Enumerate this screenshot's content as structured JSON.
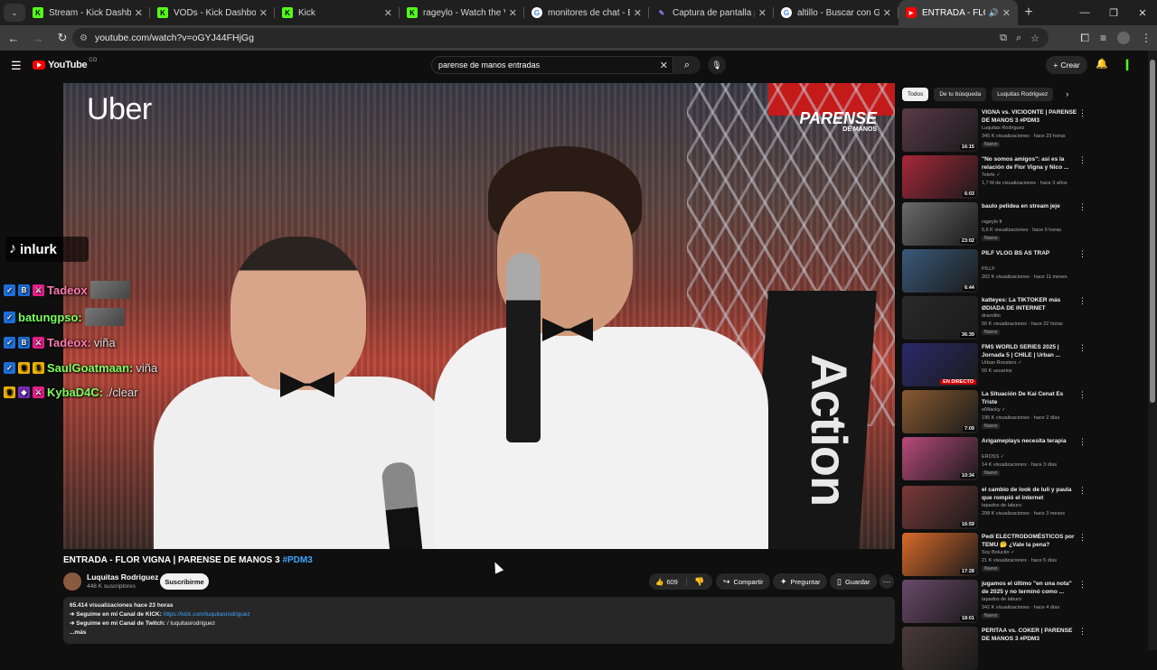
{
  "browser": {
    "tabs": [
      {
        "title": "Stream - Kick Dashboard",
        "favicon": "kick-icon"
      },
      {
        "title": "VODs - Kick Dashboard",
        "favicon": "kick-icon"
      },
      {
        "title": "Kick",
        "favicon": "kick-icon"
      },
      {
        "title": "rageylo - Watch the VOD",
        "favicon": "kick-icon"
      },
      {
        "title": "monitores de chat - Buscar",
        "favicon": "google-icon"
      },
      {
        "title": "Captura de pantalla por L",
        "favicon": "pen-icon"
      },
      {
        "title": "altillo - Buscar con Goog",
        "favicon": "google-icon"
      },
      {
        "title": "ENTRADA - FLOR VIG",
        "favicon": "youtube-icon",
        "active": true
      }
    ],
    "url": "youtube.com/watch?v=oGYJ44FHjGg"
  },
  "youtube": {
    "logo": "YouTube",
    "logo_suffix": "CO",
    "search_query": "parense de manos entradas",
    "create_label": "Crear"
  },
  "player": {
    "sponsor": "Uber",
    "watermark": "PARENSE",
    "watermark_sub": "DE MANOS",
    "pillar_text": "Action"
  },
  "overlay": {
    "tiktok_name": "inlurk",
    "chat": [
      {
        "user": "Tadeox",
        "msg": ""
      },
      {
        "user": "batungpso:",
        "msg": ""
      },
      {
        "user": "Tadeox:",
        "msg": "viña"
      },
      {
        "user": "SaulGoatmaan:",
        "msg": "viña"
      },
      {
        "user": "KybaD4C:",
        "msg": "./clear"
      }
    ]
  },
  "video": {
    "title": "ENTRADA - FLOR VIGNA | PARENSE DE MANOS 3",
    "hashtag": "#PDM3",
    "channel": "Luquitas Rodriguez",
    "subscribers": "448 K suscriptores",
    "subscribe_label": "Suscribirme",
    "likes": "609",
    "share_label": "Compartir",
    "ask_label": "Preguntar",
    "save_label": "Guardar",
    "description": {
      "stats": "65.414 visualizaciones  hace 23 horas",
      "line1_prefix": "➔ Seguime en mi Canal de KICK:",
      "line1_link": "https://kick.com/luquitasrodriguez",
      "line2_prefix": "➔ Seguime en mi Canal de Twitch:",
      "line2_link": "/ luquitasrodriguez",
      "more": "...más"
    }
  },
  "sidebar": {
    "chips": [
      "Todos",
      "De tu búsqueda",
      "Luquitas Rodriguez"
    ],
    "recommendations": [
      {
        "title": "VIGNA vs. VICIOONTE | PARENSE DE MANOS 3 #PDM3",
        "channel": "Luquitas Rodriguez",
        "meta": "345 K visualizaciones · hace 23 horas",
        "badge": "Nuevo",
        "duration": "16:15",
        "thumb_color": "#5a3a48"
      },
      {
        "title": "\"No somos amigos\": así es la relación de Flor Vigna y Nico ...",
        "channel": "Telefe ✓",
        "meta": "1,7 M de visualizaciones · hace 3 años",
        "badge": "",
        "duration": "6:03",
        "thumb_color": "#a8283a"
      },
      {
        "title": "baulo pelidea en stream jeje",
        "channel": "rageylo fr",
        "meta": "5,6 K visualizaciones · hace 6 horas",
        "badge": "Nuevo",
        "duration": "23:02",
        "thumb_color": "#6a6a6a"
      },
      {
        "title": "PILF VLOG BS AS TRAP",
        "channel": "PILLF",
        "meta": "202 K visualizaciones · hace 11 meses",
        "badge": "",
        "duration": "6:44",
        "thumb_color": "#3a5a7a"
      },
      {
        "title": "katteyes: La TIKTOKER más ØDIADA DE INTERNET",
        "channel": "dravolito",
        "meta": "50 K visualizaciones · hace 22 horas",
        "badge": "Nuevo",
        "duration": "36:39",
        "thumb_color": "#2a2a2a"
      },
      {
        "title": "FMS WORLD SERIES 2025 | Jornada 5 | CHILE | Urban ...",
        "channel": "Urban Roosters ✓",
        "meta": "50 K usuarios",
        "badge": "",
        "duration": "EN DIRECTO",
        "live": true,
        "thumb_color": "#2a2a6a"
      },
      {
        "title": "La Situación De Kai Cenat Es Triste",
        "channel": "elWacky ✓",
        "meta": "195 K visualizaciones · hace 2 días",
        "badge": "Nuevo",
        "duration": "7:09",
        "thumb_color": "#8a5a30"
      },
      {
        "title": "Arigameplays necesita terapia",
        "channel": "EROSS ✓",
        "meta": "14 K visualizaciones · hace 3 días",
        "badge": "Nuevo",
        "duration": "10:34",
        "thumb_color": "#b84a7a"
      },
      {
        "title": "el cambio de look de luli y paula que rompió el internet",
        "channel": "tapados de laburo",
        "meta": "298 K visualizaciones · hace 3 meses",
        "badge": "",
        "duration": "16:59",
        "thumb_color": "#7a3a3a"
      },
      {
        "title": "Pedí ELECTRODOMÉSTICOS por TEMU 🤔 ¿Vale la pena?",
        "channel": "Soy Bolucito ✓",
        "meta": "21 K visualizaciones · hace 5 días",
        "badge": "Nuevo",
        "duration": "17:28",
        "thumb_color": "#d86a2a"
      },
      {
        "title": "jugamos el último \"en una nota\" de 2025 y no terminó como ...",
        "channel": "tapados de laburo",
        "meta": "342 K visualizaciones · hace 4 días",
        "badge": "Nuevo",
        "duration": "18:01",
        "thumb_color": "#6a4a6a"
      },
      {
        "title": "PERITAA vs. COKER | PARENSE DE MANOS 3 #PDM3",
        "channel": "",
        "meta": "",
        "badge": "",
        "duration": "",
        "thumb_color": "#4a3a3a"
      }
    ]
  }
}
